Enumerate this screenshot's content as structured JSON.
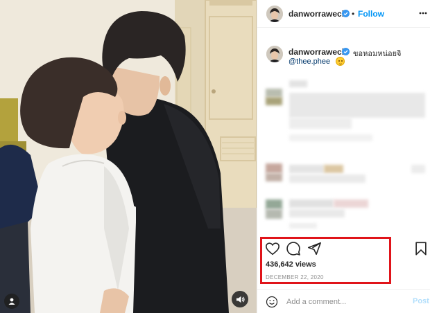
{
  "post": {
    "username": "danworrawech",
    "verified": true,
    "separator": "•",
    "follow_label": "Follow",
    "caption_text": "ขอหอมหน่อยจิ",
    "mention": "@thee.phee",
    "views": "436,642 views",
    "date": "DECEMBER 22, 2020"
  },
  "comment_box": {
    "placeholder": "Add a comment...",
    "post_label": "Post"
  },
  "icons": {
    "like": "heart-icon",
    "comment": "comment-bubble-icon",
    "share": "paper-plane-icon",
    "save": "bookmark-icon",
    "more": "more-options-icon",
    "tagged_users": "user-tag-icon",
    "sound": "speaker-icon",
    "emoji": "smile-emoji-icon",
    "verified": "verified-badge-icon"
  },
  "colors": {
    "link_blue": "#0095f6",
    "mention_blue": "#00376b",
    "verified_blue": "#3897f0",
    "highlight_red": "#e0141a",
    "muted_gray": "#8e8e8e"
  }
}
